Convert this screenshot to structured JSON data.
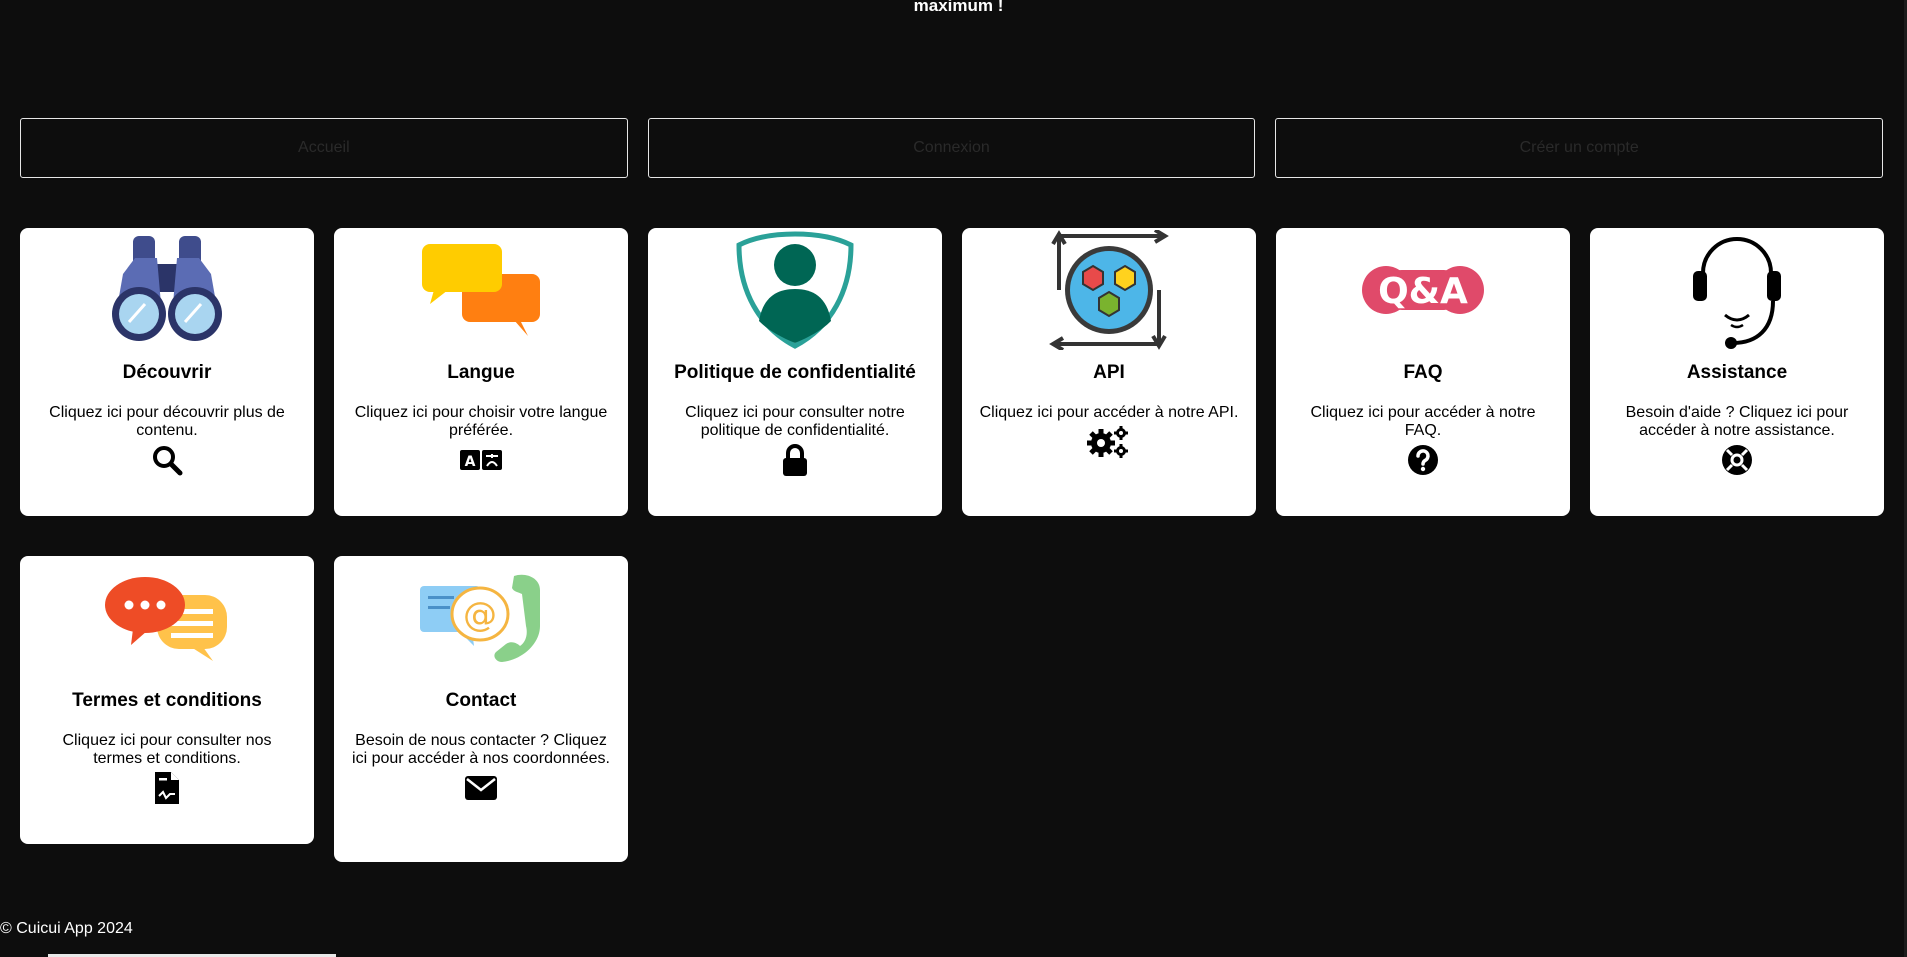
{
  "header": {
    "top_text": "maximum !"
  },
  "nav": {
    "home": "Accueil",
    "login": "Connexion",
    "register": "Créer un compte"
  },
  "cards": [
    {
      "title": "Découvrir",
      "desc": "Cliquez ici pour découvrir plus de contenu.",
      "illustration": "binoculars-icon",
      "icon": "search-icon"
    },
    {
      "title": "Langue",
      "desc": "Cliquez ici pour choisir votre langue préférée.",
      "illustration": "speech-bubbles-icon",
      "icon": "language-icon"
    },
    {
      "title": "Politique de confidentialité",
      "desc": "Cliquez ici pour consulter notre politique de confidentialité.",
      "illustration": "user-shield-icon",
      "icon": "lock-icon"
    },
    {
      "title": "API",
      "desc": "Cliquez ici pour accéder à notre API.",
      "illustration": "api-hexagons-icon",
      "icon": "gears-icon"
    },
    {
      "title": "FAQ",
      "desc": "Cliquez ici pour accéder à notre FAQ.",
      "illustration": "qa-icon",
      "illustration_text": "Q&A",
      "icon": "question-circle-icon"
    },
    {
      "title": "Assistance",
      "desc": "Besoin d'aide ? Cliquez ici pour accéder à notre assistance.",
      "illustration": "headset-icon",
      "icon": "lifebuoy-icon"
    },
    {
      "title": "Termes et conditions",
      "desc": "Cliquez ici pour consulter nos termes et conditions.",
      "illustration": "chat-bubbles-icon",
      "icon": "signed-document-icon"
    },
    {
      "title": "Contact",
      "desc": "Besoin de nous contacter ? Cliquez ici pour accéder à nos coordonnées.",
      "illustration": "contact-icon",
      "icon": "envelope-icon"
    }
  ],
  "footer": {
    "copyright": "© Cuicui App 2024"
  },
  "colors": {
    "background": "#0d0d0d",
    "card": "#ffffff",
    "text": "#000000"
  }
}
